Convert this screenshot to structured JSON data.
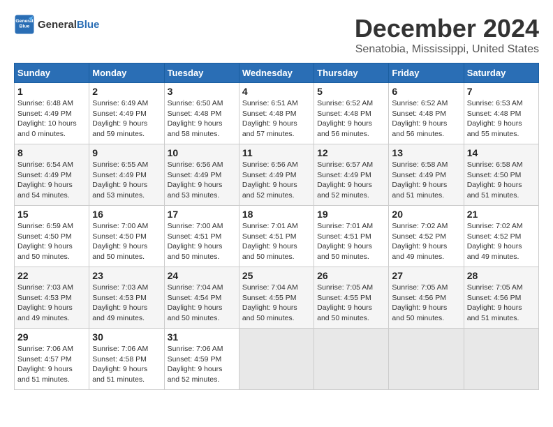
{
  "logo": {
    "line1": "General",
    "line2": "Blue"
  },
  "title": "December 2024",
  "subtitle": "Senatobia, Mississippi, United States",
  "days_of_week": [
    "Sunday",
    "Monday",
    "Tuesday",
    "Wednesday",
    "Thursday",
    "Friday",
    "Saturday"
  ],
  "weeks": [
    [
      {
        "day": "1",
        "info": "Sunrise: 6:48 AM\nSunset: 4:49 PM\nDaylight: 10 hours\nand 0 minutes."
      },
      {
        "day": "2",
        "info": "Sunrise: 6:49 AM\nSunset: 4:49 PM\nDaylight: 9 hours\nand 59 minutes."
      },
      {
        "day": "3",
        "info": "Sunrise: 6:50 AM\nSunset: 4:48 PM\nDaylight: 9 hours\nand 58 minutes."
      },
      {
        "day": "4",
        "info": "Sunrise: 6:51 AM\nSunset: 4:48 PM\nDaylight: 9 hours\nand 57 minutes."
      },
      {
        "day": "5",
        "info": "Sunrise: 6:52 AM\nSunset: 4:48 PM\nDaylight: 9 hours\nand 56 minutes."
      },
      {
        "day": "6",
        "info": "Sunrise: 6:52 AM\nSunset: 4:48 PM\nDaylight: 9 hours\nand 56 minutes."
      },
      {
        "day": "7",
        "info": "Sunrise: 6:53 AM\nSunset: 4:48 PM\nDaylight: 9 hours\nand 55 minutes."
      }
    ],
    [
      {
        "day": "8",
        "info": "Sunrise: 6:54 AM\nSunset: 4:49 PM\nDaylight: 9 hours\nand 54 minutes."
      },
      {
        "day": "9",
        "info": "Sunrise: 6:55 AM\nSunset: 4:49 PM\nDaylight: 9 hours\nand 53 minutes."
      },
      {
        "day": "10",
        "info": "Sunrise: 6:56 AM\nSunset: 4:49 PM\nDaylight: 9 hours\nand 53 minutes."
      },
      {
        "day": "11",
        "info": "Sunrise: 6:56 AM\nSunset: 4:49 PM\nDaylight: 9 hours\nand 52 minutes."
      },
      {
        "day": "12",
        "info": "Sunrise: 6:57 AM\nSunset: 4:49 PM\nDaylight: 9 hours\nand 52 minutes."
      },
      {
        "day": "13",
        "info": "Sunrise: 6:58 AM\nSunset: 4:49 PM\nDaylight: 9 hours\nand 51 minutes."
      },
      {
        "day": "14",
        "info": "Sunrise: 6:58 AM\nSunset: 4:50 PM\nDaylight: 9 hours\nand 51 minutes."
      }
    ],
    [
      {
        "day": "15",
        "info": "Sunrise: 6:59 AM\nSunset: 4:50 PM\nDaylight: 9 hours\nand 50 minutes."
      },
      {
        "day": "16",
        "info": "Sunrise: 7:00 AM\nSunset: 4:50 PM\nDaylight: 9 hours\nand 50 minutes."
      },
      {
        "day": "17",
        "info": "Sunrise: 7:00 AM\nSunset: 4:51 PM\nDaylight: 9 hours\nand 50 minutes."
      },
      {
        "day": "18",
        "info": "Sunrise: 7:01 AM\nSunset: 4:51 PM\nDaylight: 9 hours\nand 50 minutes."
      },
      {
        "day": "19",
        "info": "Sunrise: 7:01 AM\nSunset: 4:51 PM\nDaylight: 9 hours\nand 50 minutes."
      },
      {
        "day": "20",
        "info": "Sunrise: 7:02 AM\nSunset: 4:52 PM\nDaylight: 9 hours\nand 49 minutes."
      },
      {
        "day": "21",
        "info": "Sunrise: 7:02 AM\nSunset: 4:52 PM\nDaylight: 9 hours\nand 49 minutes."
      }
    ],
    [
      {
        "day": "22",
        "info": "Sunrise: 7:03 AM\nSunset: 4:53 PM\nDaylight: 9 hours\nand 49 minutes."
      },
      {
        "day": "23",
        "info": "Sunrise: 7:03 AM\nSunset: 4:53 PM\nDaylight: 9 hours\nand 49 minutes."
      },
      {
        "day": "24",
        "info": "Sunrise: 7:04 AM\nSunset: 4:54 PM\nDaylight: 9 hours\nand 50 minutes."
      },
      {
        "day": "25",
        "info": "Sunrise: 7:04 AM\nSunset: 4:55 PM\nDaylight: 9 hours\nand 50 minutes."
      },
      {
        "day": "26",
        "info": "Sunrise: 7:05 AM\nSunset: 4:55 PM\nDaylight: 9 hours\nand 50 minutes."
      },
      {
        "day": "27",
        "info": "Sunrise: 7:05 AM\nSunset: 4:56 PM\nDaylight: 9 hours\nand 50 minutes."
      },
      {
        "day": "28",
        "info": "Sunrise: 7:05 AM\nSunset: 4:56 PM\nDaylight: 9 hours\nand 51 minutes."
      }
    ],
    [
      {
        "day": "29",
        "info": "Sunrise: 7:06 AM\nSunset: 4:57 PM\nDaylight: 9 hours\nand 51 minutes."
      },
      {
        "day": "30",
        "info": "Sunrise: 7:06 AM\nSunset: 4:58 PM\nDaylight: 9 hours\nand 51 minutes."
      },
      {
        "day": "31",
        "info": "Sunrise: 7:06 AM\nSunset: 4:59 PM\nDaylight: 9 hours\nand 52 minutes."
      },
      {
        "day": "",
        "info": ""
      },
      {
        "day": "",
        "info": ""
      },
      {
        "day": "",
        "info": ""
      },
      {
        "day": "",
        "info": ""
      }
    ]
  ]
}
